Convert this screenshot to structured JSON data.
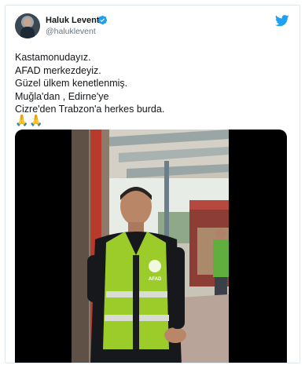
{
  "tweet": {
    "author": {
      "name": "Haluk Levent",
      "handle": "@haluklevent",
      "verified": true
    },
    "text_lines": [
      "Kastamonudayız.",
      "AFAD merkezdeyiz.",
      "Güzel ülkem kenetlenmiş.",
      "Muğla'dan , Edirne'ye",
      "Cizre'den Trabzon'a herkes burda."
    ],
    "emoji": [
      "🙏",
      "🙏"
    ],
    "media": {
      "type": "video",
      "vest_logo_text": "AFAD"
    }
  },
  "icons": {
    "verified": "verified-badge-icon",
    "brand": "twitter-bird-icon"
  },
  "colors": {
    "brand_blue": "#1da1f2",
    "text_primary": "#14171a",
    "text_secondary": "#657786",
    "border": "#e1e8ed",
    "vest_green": "#9ccc2a"
  }
}
